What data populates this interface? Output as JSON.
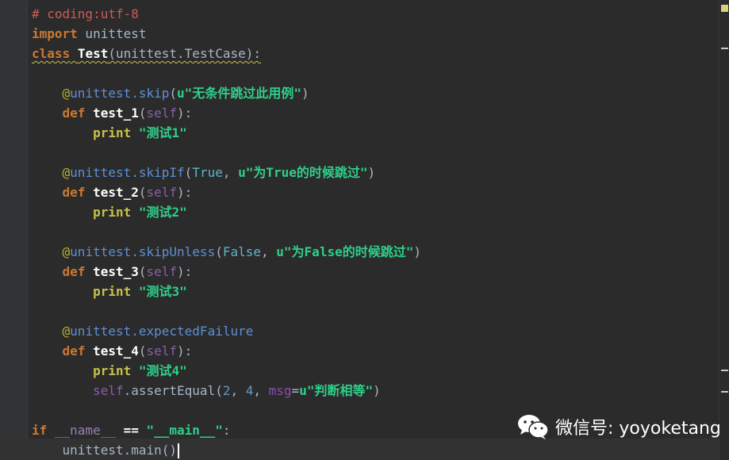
{
  "editor": {
    "lines": [
      {
        "tokens": [
          {
            "t": "# coding:utf-8",
            "c": "cmt"
          }
        ]
      },
      {
        "tokens": [
          {
            "t": "import",
            "c": "kw"
          },
          {
            "t": " unittest",
            "c": ""
          }
        ]
      },
      {
        "tokens": [
          {
            "t": "class",
            "c": "kw squig"
          },
          {
            "t": " ",
            "c": "squig"
          },
          {
            "t": "Test",
            "c": "func squig"
          },
          {
            "t": "(unittest.TestCase):",
            "c": "squig"
          }
        ]
      },
      {
        "tokens": []
      },
      {
        "tokens": [
          {
            "t": "    @",
            "c": "deco"
          },
          {
            "t": "unittest.skip",
            "c": "deconame"
          },
          {
            "t": "(",
            "c": ""
          },
          {
            "t": "u\"无条件跳过此用例\"",
            "c": "str"
          },
          {
            "t": ")",
            "c": ""
          }
        ]
      },
      {
        "tokens": [
          {
            "t": "    ",
            "c": ""
          },
          {
            "t": "def",
            "c": "kw"
          },
          {
            "t": " ",
            "c": ""
          },
          {
            "t": "test_1",
            "c": "func"
          },
          {
            "t": "(",
            "c": ""
          },
          {
            "t": "self",
            "c": "selfc"
          },
          {
            "t": "):",
            "c": ""
          }
        ]
      },
      {
        "tokens": [
          {
            "t": "        ",
            "c": ""
          },
          {
            "t": "print",
            "c": "printkw"
          },
          {
            "t": " ",
            "c": ""
          },
          {
            "t": "\"测试1\"",
            "c": "str"
          }
        ]
      },
      {
        "tokens": []
      },
      {
        "tokens": [
          {
            "t": "    @",
            "c": "deco"
          },
          {
            "t": "unittest.skipIf",
            "c": "deconame"
          },
          {
            "t": "(",
            "c": ""
          },
          {
            "t": "True",
            "c": "builtin"
          },
          {
            "t": ", ",
            "c": ""
          },
          {
            "t": "u\"为True的时候跳过\"",
            "c": "str"
          },
          {
            "t": ")",
            "c": ""
          }
        ]
      },
      {
        "tokens": [
          {
            "t": "    ",
            "c": ""
          },
          {
            "t": "def",
            "c": "kw"
          },
          {
            "t": " ",
            "c": ""
          },
          {
            "t": "test_2",
            "c": "func"
          },
          {
            "t": "(",
            "c": ""
          },
          {
            "t": "self",
            "c": "selfc"
          },
          {
            "t": "):",
            "c": ""
          }
        ]
      },
      {
        "tokens": [
          {
            "t": "        ",
            "c": ""
          },
          {
            "t": "print",
            "c": "printkw"
          },
          {
            "t": " ",
            "c": ""
          },
          {
            "t": "\"测试2\"",
            "c": "str"
          }
        ]
      },
      {
        "tokens": []
      },
      {
        "tokens": [
          {
            "t": "    @",
            "c": "deco"
          },
          {
            "t": "unittest.skipUnless",
            "c": "deconame"
          },
          {
            "t": "(",
            "c": ""
          },
          {
            "t": "False",
            "c": "builtin"
          },
          {
            "t": ", ",
            "c": ""
          },
          {
            "t": "u\"为False的时候跳过\"",
            "c": "str"
          },
          {
            "t": ")",
            "c": ""
          }
        ]
      },
      {
        "tokens": [
          {
            "t": "    ",
            "c": ""
          },
          {
            "t": "def",
            "c": "kw"
          },
          {
            "t": " ",
            "c": ""
          },
          {
            "t": "test_3",
            "c": "func"
          },
          {
            "t": "(",
            "c": ""
          },
          {
            "t": "self",
            "c": "selfc"
          },
          {
            "t": "):",
            "c": ""
          }
        ]
      },
      {
        "tokens": [
          {
            "t": "        ",
            "c": ""
          },
          {
            "t": "print",
            "c": "printkw"
          },
          {
            "t": " ",
            "c": ""
          },
          {
            "t": "\"测试3\"",
            "c": "str"
          }
        ]
      },
      {
        "tokens": []
      },
      {
        "tokens": [
          {
            "t": "    @",
            "c": "deco"
          },
          {
            "t": "unittest.expectedFailure",
            "c": "deconame"
          }
        ]
      },
      {
        "tokens": [
          {
            "t": "    ",
            "c": ""
          },
          {
            "t": "def",
            "c": "kw"
          },
          {
            "t": " ",
            "c": ""
          },
          {
            "t": "test_4",
            "c": "func"
          },
          {
            "t": "(",
            "c": ""
          },
          {
            "t": "self",
            "c": "selfc"
          },
          {
            "t": "):",
            "c": ""
          }
        ]
      },
      {
        "tokens": [
          {
            "t": "        ",
            "c": ""
          },
          {
            "t": "print",
            "c": "printkw"
          },
          {
            "t": " ",
            "c": ""
          },
          {
            "t": "\"测试4\"",
            "c": "str"
          }
        ]
      },
      {
        "tokens": [
          {
            "t": "        ",
            "c": ""
          },
          {
            "t": "self",
            "c": "selfc"
          },
          {
            "t": ".assertEqual(",
            "c": ""
          },
          {
            "t": "2",
            "c": "num"
          },
          {
            "t": ", ",
            "c": ""
          },
          {
            "t": "4",
            "c": "num"
          },
          {
            "t": ", ",
            "c": ""
          },
          {
            "t": "msg",
            "c": "kwarg"
          },
          {
            "t": "=",
            "c": ""
          },
          {
            "t": "u\"判断相等\"",
            "c": "str"
          },
          {
            "t": ")",
            "c": ""
          }
        ]
      },
      {
        "tokens": []
      },
      {
        "tokens": [
          {
            "t": "if",
            "c": "kw"
          },
          {
            "t": " __name__ ",
            "c": "dunder"
          },
          {
            "t": "==",
            "c": "func"
          },
          {
            "t": " ",
            "c": ""
          },
          {
            "t": "\"__main__\"",
            "c": "str"
          },
          {
            "t": ":",
            "c": ""
          }
        ]
      },
      {
        "tokens": [
          {
            "t": "    unittest.main",
            "c": ""
          },
          {
            "t": "()",
            "c": ""
          }
        ],
        "current": true
      }
    ]
  },
  "watermark": {
    "text": "微信号: yoyoketang",
    "icon": "wechat-icon"
  },
  "colors": {
    "background": "#2b2b2b",
    "keyword": "#cc7832",
    "string": "#2fcf8a",
    "comment": "#cf5b56"
  }
}
